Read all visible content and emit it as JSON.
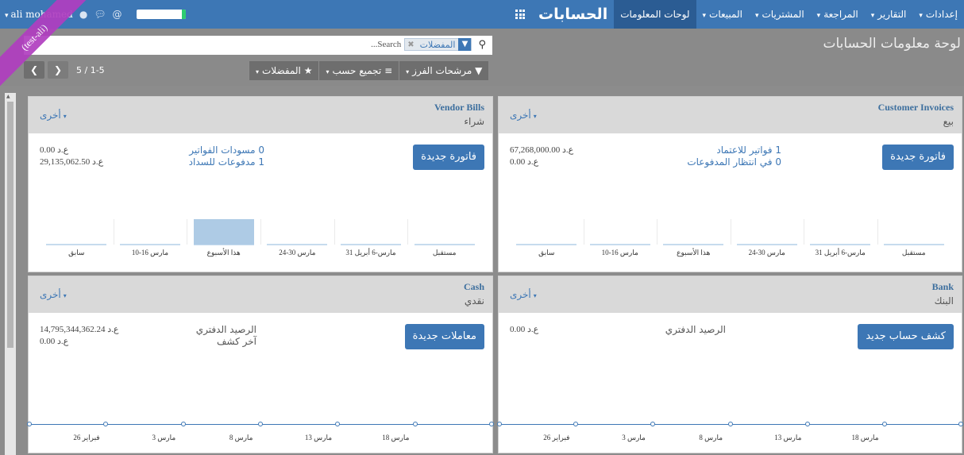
{
  "topbar": {
    "user_name": "ali mohamed",
    "app_title": "الحسابات",
    "menu": [
      {
        "label": "لوحات المعلومات",
        "active": true,
        "dropdown": false
      },
      {
        "label": "المبيعات",
        "active": false,
        "dropdown": true
      },
      {
        "label": "المشتريات",
        "active": false,
        "dropdown": true
      },
      {
        "label": "المراجعة",
        "active": false,
        "dropdown": true
      },
      {
        "label": "التقارير",
        "active": false,
        "dropdown": true
      },
      {
        "label": "إعدادات",
        "active": false,
        "dropdown": true
      }
    ],
    "icons": [
      "caret-down-icon",
      "user-icon",
      "chat-icon",
      "at-icon",
      "apps-grid-icon"
    ]
  },
  "ribbon": "(test-ali)",
  "control": {
    "breadcrumb": "لوحة معلومات الحسابات",
    "search_placeholder": "...Search",
    "facet_label": "المفضلات",
    "filter_buttons": [
      "مرشحات الفرز",
      "تجميع حسب",
      "المفضلات"
    ],
    "pager_value": "5 / 1-5"
  },
  "cards": {
    "customer_invoices": {
      "title_en": "Customer Invoices",
      "title_ar": "بيع",
      "more": "أخرى",
      "button": "فاتورة جديدة",
      "links": [
        "1 فواتير للاعتماد",
        "0 في انتظار المدفوعات"
      ],
      "amounts": [
        "67,268,000.00 ع.د",
        "0.00 ع.د"
      ],
      "bar_labels": [
        "سابق",
        "10-16 مارس",
        "هذا الأسبوع",
        "24-30 مارس",
        "31 مارس-6 أبريل",
        "مستقبل"
      ]
    },
    "vendor_bills": {
      "title_en": "Vendor Bills",
      "title_ar": "شراء",
      "more": "أخرى",
      "button": "فاتورة جديدة",
      "links": [
        "0 مسودات الفواتير",
        "1 مدفوعات للسداد"
      ],
      "amounts": [
        "0.00 ع.د",
        "29,135,062.50 ع.د"
      ],
      "bar_labels": [
        "سابق",
        "10-16 مارس",
        "هذا الأسبوع",
        "24-30 مارس",
        "31 مارس-6 أبريل",
        "مستقبل"
      ]
    },
    "bank": {
      "title_en": "Bank",
      "title_ar": "البنك",
      "more": "أخرى",
      "button": "كشف حساب جديد",
      "links": [
        "الرصيد الدفتري"
      ],
      "amounts": [
        "0.00 ع.د"
      ],
      "line_labels": [
        "26 فبراير",
        "3 مارس",
        "8 مارس",
        "13 مارس",
        "18 مارس"
      ]
    },
    "cash": {
      "title_en": "Cash",
      "title_ar": "نقدي",
      "more": "أخرى",
      "button": "معاملات جديدة",
      "links": [
        "الرصيد الدفتري",
        "آخر كشف"
      ],
      "amounts": [
        "14,795,344,362.24 ع.د",
        "0.00 ع.د"
      ],
      "line_labels": [
        "26 فبراير",
        "3 مارس",
        "8 مارس",
        "13 مارس",
        "18 مارس"
      ]
    }
  },
  "chart_data": [
    {
      "type": "bar",
      "title": "Customer Invoices",
      "categories": [
        "سابق",
        "10-16 مارس",
        "هذا الأسبوع",
        "24-30 مارس",
        "31 مارس-6 أبريل",
        "مستقبل"
      ],
      "values": [
        0,
        0,
        0,
        0,
        0,
        0
      ]
    },
    {
      "type": "bar",
      "title": "Vendor Bills",
      "categories": [
        "سابق",
        "10-16 مارس",
        "هذا الأسبوع",
        "24-30 مارس",
        "31 مارس-6 أبريل",
        "مستقبل"
      ],
      "values": [
        0,
        0,
        1,
        0,
        0,
        0
      ]
    },
    {
      "type": "line",
      "title": "Bank",
      "x": [
        "26 فبراير",
        "3 مارس",
        "8 مارس",
        "13 مارس",
        "18 مارس"
      ],
      "values": [
        0,
        0,
        0,
        0,
        0
      ]
    },
    {
      "type": "line",
      "title": "Cash",
      "x": [
        "26 فبراير",
        "3 مارس",
        "8 مارس",
        "13 مارس",
        "18 مارس"
      ],
      "values": [
        0,
        0,
        0,
        0,
        0
      ]
    }
  ]
}
